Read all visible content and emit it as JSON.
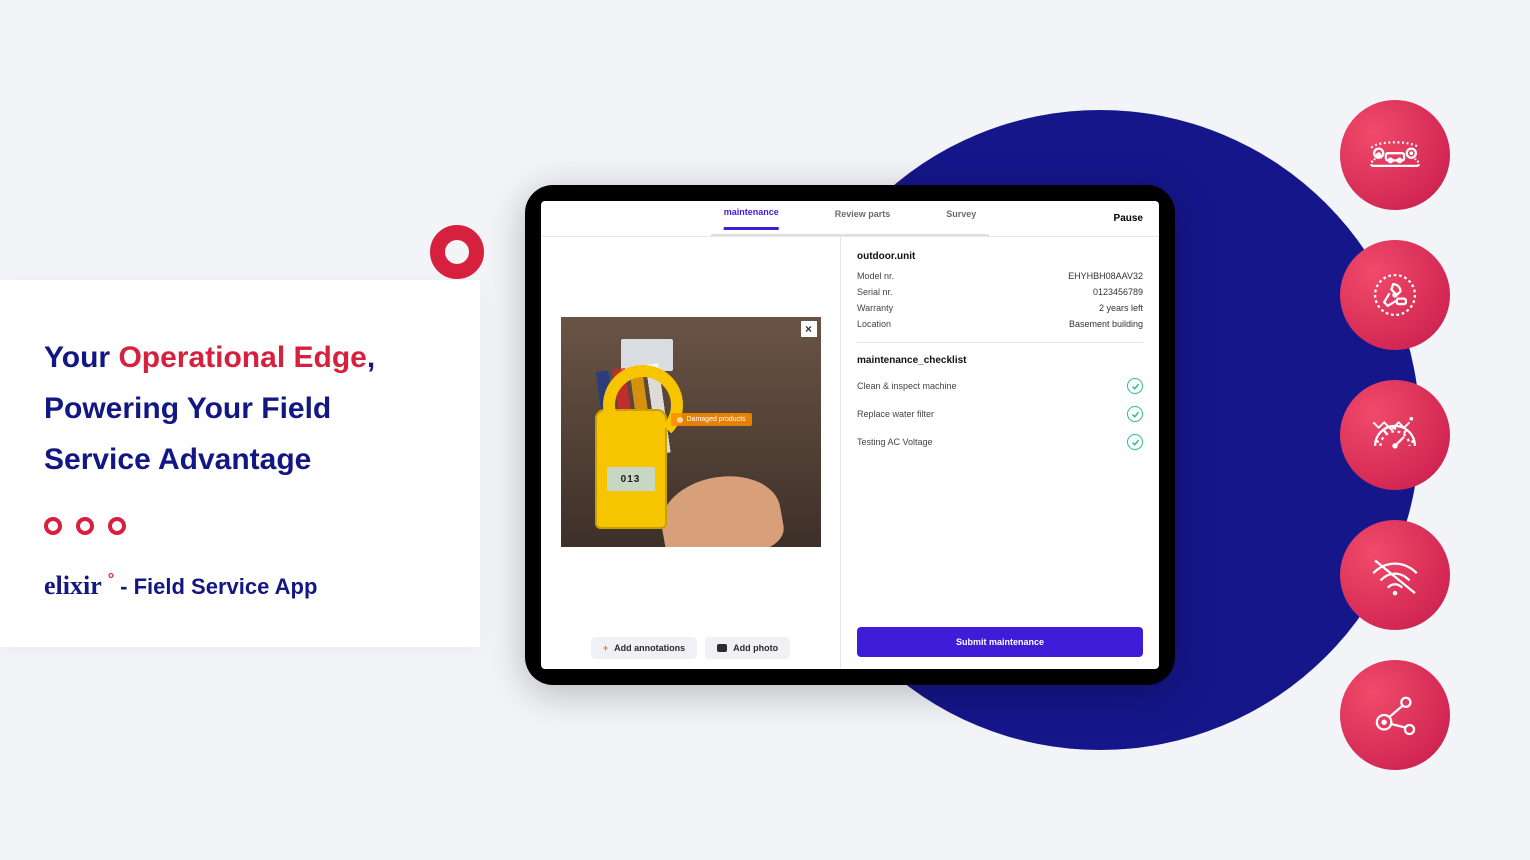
{
  "marketing": {
    "headline_pre": "Your ",
    "headline_accent": "Operational Edge",
    "headline_post": ", Powering Your Field Service Advantage",
    "brand_name": "elixir",
    "brand_suffix": "- Field Service App"
  },
  "tablet": {
    "tabs": [
      "maintenance",
      "Review parts",
      "Survey"
    ],
    "active_tab": "maintenance",
    "pause_label": "Pause",
    "photo": {
      "annotation_tag": "Damaged products",
      "meter_reading": "013",
      "buttons": {
        "annotate": "Add annotations",
        "add_photo": "Add photo"
      }
    },
    "unit": {
      "title": "outdoor.unit",
      "rows": [
        {
          "k": "Model nr.",
          "v": "EHYHBH08AAV32"
        },
        {
          "k": "Serial nr.",
          "v": "0123456789"
        },
        {
          "k": "Warranty",
          "v": "2 years left"
        },
        {
          "k": "Location",
          "v": "Basement building"
        }
      ]
    },
    "checklist": {
      "title": "maintenance_checklist",
      "items": [
        "Clean & inspect machine",
        "Replace water filter",
        "Testing AC Voltage"
      ]
    },
    "submit_label": "Submit maintenance"
  },
  "feature_icons": [
    "vehicle-tracking-icon",
    "service-tools-icon",
    "dashboard-gauge-icon",
    "offline-wifi-icon",
    "hub-network-icon"
  ]
}
